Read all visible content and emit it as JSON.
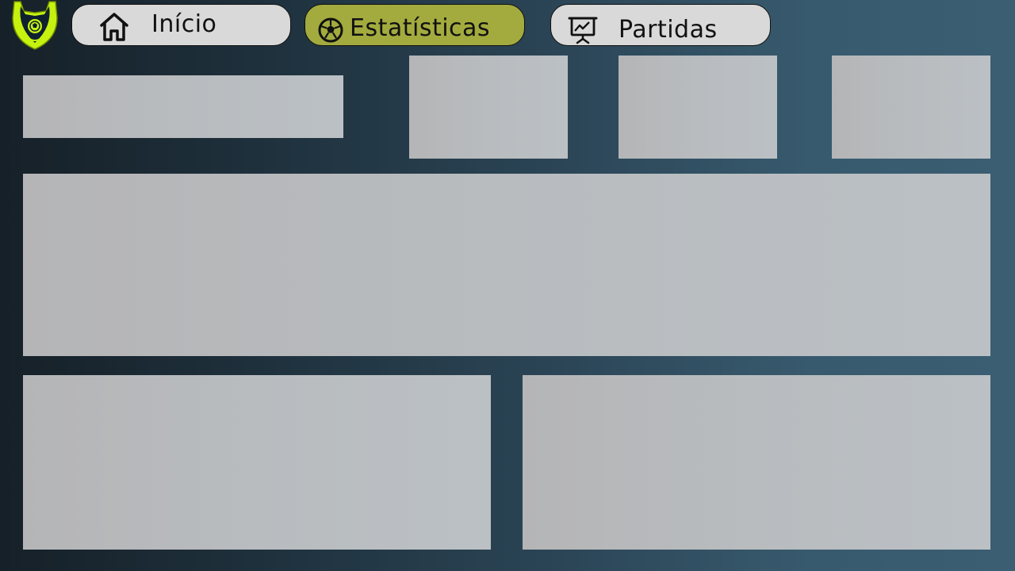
{
  "app": {
    "logo_icon": "championship-trophy-logo",
    "colors": {
      "accent": "#a3ab3e",
      "logo": "#c6f20f",
      "button_bg": "#d9d9d9",
      "panel": "#b8bcbf"
    }
  },
  "nav": {
    "items": [
      {
        "label": "Início",
        "icon": "home-icon",
        "active": false
      },
      {
        "label": "Estatísticas",
        "icon": "soccer-ball-icon",
        "active": true
      },
      {
        "label": "Partidas",
        "icon": "presentation-chart-icon",
        "active": false
      }
    ]
  }
}
